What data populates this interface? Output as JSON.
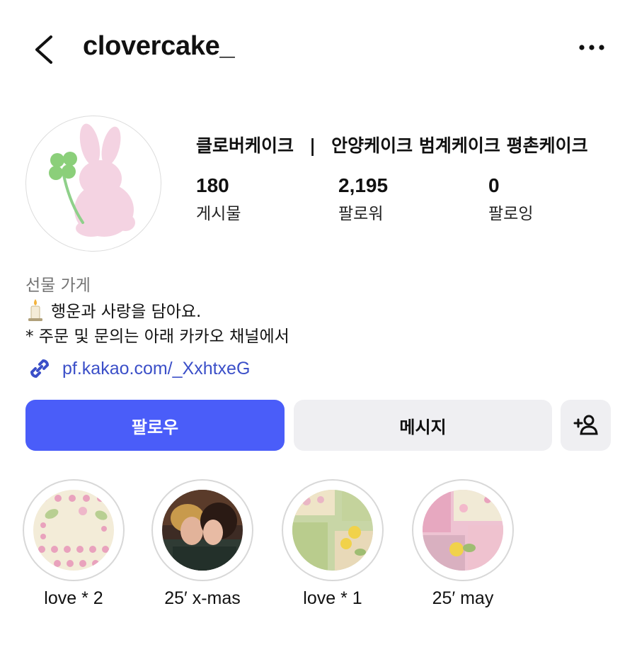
{
  "header": {
    "username": "clovercake_",
    "back_icon": "chevron-left-icon",
    "more_icon": "more-horizontal-icon"
  },
  "profile": {
    "display_name_left": "클로버케이크",
    "separator": "|",
    "display_name_right": "안양케이크 범계케이크 평촌케이크",
    "stats": [
      {
        "value": "180",
        "label": "게시물"
      },
      {
        "value": "2,195",
        "label": "팔로워"
      },
      {
        "value": "0",
        "label": "팔로잉"
      }
    ],
    "category": "선물 가게",
    "bio_line1": "행운과 사랑을 담아요.",
    "bio_line1_icon": "candle-icon",
    "bio_line2": "* 주문 및 문의는 아래 카카오 채널에서",
    "link": "pf.kakao.com/_XxhtxeG",
    "link_icon": "link-icon"
  },
  "actions": {
    "follow": "팔로우",
    "message": "메시지",
    "suggest_icon": "add-person-icon"
  },
  "highlights": [
    {
      "label": "love * 2"
    },
    {
      "label": "25′ x-mas"
    },
    {
      "label": "love * 1"
    },
    {
      "label": "25′ may"
    }
  ],
  "colors": {
    "accent": "#4a5df9",
    "link": "#3b4fc8",
    "secondary_button": "#efeff2"
  }
}
